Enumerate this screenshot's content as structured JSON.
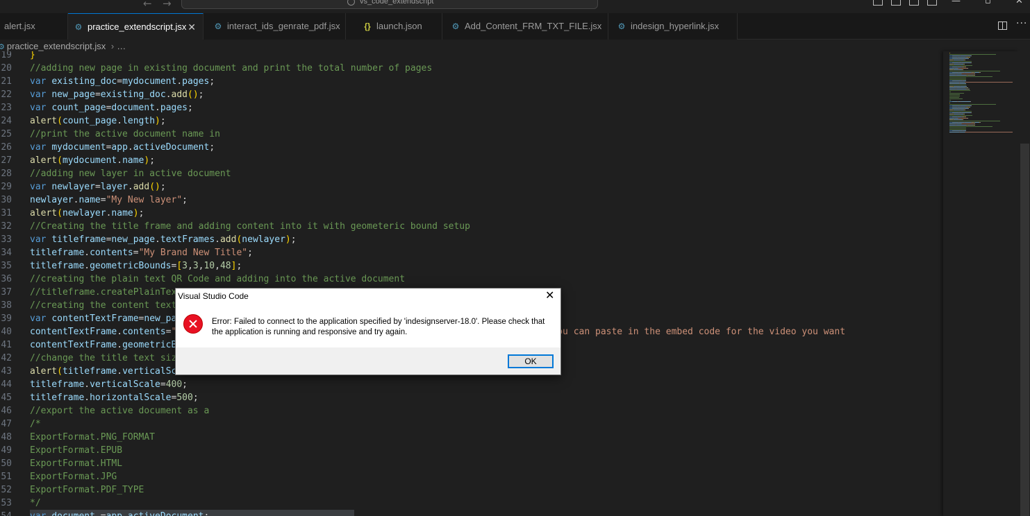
{
  "window": {
    "command_center": "vs_code_extendscript"
  },
  "tabs": [
    {
      "label": "alert.jsx",
      "icon": "gear-icon",
      "active": false
    },
    {
      "label": "practice_extendscript.jsx",
      "icon": "gear-icon",
      "active": true
    },
    {
      "label": "interact_ids_genrate_pdf.jsx",
      "icon": "gear-icon",
      "active": false
    },
    {
      "label": "launch.json",
      "icon": "braces-icon",
      "active": false
    },
    {
      "label": "Add_Content_FRM_TXT_FILE.jsx",
      "icon": "gear-icon",
      "active": false
    },
    {
      "label": "indesign_hyperlink.jsx",
      "icon": "gear-icon",
      "active": false
    }
  ],
  "breadcrumb": {
    "file": "practice_extendscript.jsx",
    "ellipsis": "…"
  },
  "editor": {
    "lines": [
      {
        "n": "19",
        "tokens": [
          [
            "br",
            "}"
          ]
        ]
      },
      {
        "n": "20",
        "tokens": [
          [
            "cm",
            "//adding new page in existing document and print the total number of pages"
          ]
        ]
      },
      {
        "n": "21",
        "tokens": [
          [
            "kw",
            "var "
          ],
          [
            "vr",
            "existing_doc"
          ],
          [
            "pn",
            "="
          ],
          [
            "vr",
            "mydocument"
          ],
          [
            "pn",
            "."
          ],
          [
            "vr",
            "pages"
          ],
          [
            "pn",
            ";"
          ]
        ]
      },
      {
        "n": "22",
        "tokens": [
          [
            "kw",
            "var "
          ],
          [
            "vr",
            "new_page"
          ],
          [
            "pn",
            "="
          ],
          [
            "vr",
            "existing_doc"
          ],
          [
            "pn",
            "."
          ],
          [
            "fn",
            "add"
          ],
          [
            "br",
            "()"
          ],
          [
            "pn",
            ";"
          ]
        ]
      },
      {
        "n": "23",
        "tokens": [
          [
            "kw",
            "var "
          ],
          [
            "vr",
            "count_page"
          ],
          [
            "pn",
            "="
          ],
          [
            "vr",
            "document"
          ],
          [
            "pn",
            "."
          ],
          [
            "vr",
            "pages"
          ],
          [
            "pn",
            ";"
          ]
        ]
      },
      {
        "n": "24",
        "tokens": [
          [
            "fn",
            "alert"
          ],
          [
            "br",
            "("
          ],
          [
            "vr",
            "count_page"
          ],
          [
            "pn",
            "."
          ],
          [
            "vr",
            "length"
          ],
          [
            "br",
            ")"
          ],
          [
            "pn",
            ";"
          ]
        ]
      },
      {
        "n": "25",
        "tokens": [
          [
            "cm",
            "//print the active document name in"
          ]
        ]
      },
      {
        "n": "26",
        "tokens": [
          [
            "kw",
            "var "
          ],
          [
            "vr",
            "mydocument"
          ],
          [
            "pn",
            "="
          ],
          [
            "vr",
            "app"
          ],
          [
            "pn",
            "."
          ],
          [
            "vr",
            "activeDocument"
          ],
          [
            "pn",
            ";"
          ]
        ]
      },
      {
        "n": "27",
        "tokens": [
          [
            "fn",
            "alert"
          ],
          [
            "br",
            "("
          ],
          [
            "vr",
            "mydocument"
          ],
          [
            "pn",
            "."
          ],
          [
            "vr",
            "name"
          ],
          [
            "br",
            ")"
          ],
          [
            "pn",
            ";"
          ]
        ]
      },
      {
        "n": "28",
        "tokens": [
          [
            "cm",
            "//adding new layer in active document"
          ]
        ]
      },
      {
        "n": "29",
        "tokens": [
          [
            "kw",
            "var "
          ],
          [
            "vr",
            "newlayer"
          ],
          [
            "pn",
            "="
          ],
          [
            "vr",
            "layer"
          ],
          [
            "pn",
            "."
          ],
          [
            "fn",
            "add"
          ],
          [
            "br",
            "()"
          ],
          [
            "pn",
            ";"
          ]
        ]
      },
      {
        "n": "30",
        "tokens": [
          [
            "vr",
            "newlayer"
          ],
          [
            "pn",
            "."
          ],
          [
            "vr",
            "name"
          ],
          [
            "pn",
            "="
          ],
          [
            "st",
            "\"My New layer\""
          ],
          [
            "pn",
            ";"
          ]
        ]
      },
      {
        "n": "31",
        "tokens": [
          [
            "fn",
            "alert"
          ],
          [
            "br",
            "("
          ],
          [
            "vr",
            "newlayer"
          ],
          [
            "pn",
            "."
          ],
          [
            "vr",
            "name"
          ],
          [
            "br",
            ")"
          ],
          [
            "pn",
            ";"
          ]
        ]
      },
      {
        "n": "32",
        "tokens": [
          [
            "cm",
            "//Creating the title frame and adding content into it with geometeric bound setup"
          ]
        ]
      },
      {
        "n": "33",
        "tokens": [
          [
            "kw",
            "var "
          ],
          [
            "vr",
            "titleframe"
          ],
          [
            "pn",
            "="
          ],
          [
            "vr",
            "new_page"
          ],
          [
            "pn",
            "."
          ],
          [
            "vr",
            "textFrames"
          ],
          [
            "pn",
            "."
          ],
          [
            "fn",
            "add"
          ],
          [
            "br",
            "("
          ],
          [
            "vr",
            "newlayer"
          ],
          [
            "br",
            ")"
          ],
          [
            "pn",
            ";"
          ]
        ]
      },
      {
        "n": "34",
        "tokens": [
          [
            "vr",
            "titleframe"
          ],
          [
            "pn",
            "."
          ],
          [
            "vr",
            "contents"
          ],
          [
            "pn",
            "="
          ],
          [
            "st",
            "\"My Brand New Title\""
          ],
          [
            "pn",
            ";"
          ]
        ]
      },
      {
        "n": "35",
        "tokens": [
          [
            "vr",
            "titleframe"
          ],
          [
            "pn",
            "."
          ],
          [
            "vr",
            "geometricBounds"
          ],
          [
            "pn",
            "="
          ],
          [
            "br",
            "["
          ],
          [
            "nm",
            "3"
          ],
          [
            "pn",
            ","
          ],
          [
            "nm",
            "3"
          ],
          [
            "pn",
            ","
          ],
          [
            "nm",
            "10"
          ],
          [
            "pn",
            ","
          ],
          [
            "nm",
            "48"
          ],
          [
            "br",
            "]"
          ],
          [
            "pn",
            ";"
          ]
        ]
      },
      {
        "n": "36",
        "tokens": [
          [
            "cm",
            "//creating the plain text QR Code and adding into the active document"
          ]
        ]
      },
      {
        "n": "37",
        "tokens": [
          [
            "cm",
            "//titleframe.createPlainTex"
          ]
        ]
      },
      {
        "n": "38",
        "tokens": [
          [
            "cm",
            "//creating the content text"
          ]
        ]
      },
      {
        "n": "39",
        "tokens": [
          [
            "kw",
            "var "
          ],
          [
            "vr",
            "contentTextFrame"
          ],
          [
            "pn",
            "="
          ],
          [
            "vr",
            "new_pa"
          ]
        ]
      },
      {
        "n": "40",
        "tokens": [
          [
            "vr",
            "contentTextFrame"
          ],
          [
            "pn",
            "."
          ],
          [
            "vr",
            "contents"
          ],
          [
            "pn",
            "="
          ],
          [
            "st",
            "\"                                                    ck Online Video, you can paste in the embed code for the video you want"
          ]
        ]
      },
      {
        "n": "41",
        "tokens": [
          [
            "vr",
            "contentTextFrame"
          ],
          [
            "pn",
            "."
          ],
          [
            "vr",
            "geometricB"
          ]
        ]
      },
      {
        "n": "42",
        "tokens": [
          [
            "cm",
            "//change the title text siz"
          ]
        ]
      },
      {
        "n": "43",
        "tokens": [
          [
            "fn",
            "alert"
          ],
          [
            "br",
            "("
          ],
          [
            "vr",
            "titleframe"
          ],
          [
            "pn",
            "."
          ],
          [
            "vr",
            "verticalSc"
          ]
        ]
      },
      {
        "n": "44",
        "tokens": [
          [
            "vr",
            "titleframe"
          ],
          [
            "pn",
            "."
          ],
          [
            "vr",
            "verticalScale"
          ],
          [
            "pn",
            "="
          ],
          [
            "nm",
            "400"
          ],
          [
            "pn",
            ";"
          ]
        ]
      },
      {
        "n": "45",
        "tokens": [
          [
            "vr",
            "titleframe"
          ],
          [
            "pn",
            "."
          ],
          [
            "vr",
            "horizontalScale"
          ],
          [
            "pn",
            "="
          ],
          [
            "nm",
            "500"
          ],
          [
            "pn",
            ";"
          ]
        ]
      },
      {
        "n": "46",
        "tokens": [
          [
            "cm",
            "//export the active document as a"
          ]
        ]
      },
      {
        "n": "47",
        "tokens": [
          [
            "cm",
            "/*"
          ]
        ]
      },
      {
        "n": "48",
        "tokens": [
          [
            "cm",
            "ExportFormat.PNG_FORMAT"
          ]
        ]
      },
      {
        "n": "49",
        "tokens": [
          [
            "cm",
            "ExportFormat.EPUB"
          ]
        ]
      },
      {
        "n": "50",
        "tokens": [
          [
            "cm",
            "ExportFormat.HTML"
          ]
        ]
      },
      {
        "n": "51",
        "tokens": [
          [
            "cm",
            "ExportFormat.JPG"
          ]
        ]
      },
      {
        "n": "52",
        "tokens": [
          [
            "cm",
            "ExportFormat.PDF_TYPE"
          ]
        ]
      },
      {
        "n": "53",
        "tokens": [
          [
            "cm",
            "*/"
          ]
        ]
      },
      {
        "n": "54",
        "tokens": [
          [
            "kw",
            "var "
          ],
          [
            "vr",
            "document"
          ],
          [
            "pn",
            " ="
          ],
          [
            "vr",
            "app"
          ],
          [
            "pn",
            "."
          ],
          [
            "vr",
            "activeDocument"
          ],
          [
            "pn",
            ";"
          ]
        ]
      }
    ]
  },
  "dialog": {
    "title": "Visual Studio Code",
    "message": "Error: Failed to connect to the application specified by 'indesignserver-18.0'. Please check that the application is running and responsive and try again.",
    "ok_label": "OK",
    "close_glyph": "✕",
    "icon": "error-icon"
  },
  "colors": {
    "accent": "#0078d4",
    "error": "#e81123",
    "comment": "#6a9955",
    "keyword": "#569cd6",
    "string": "#ce9178"
  }
}
